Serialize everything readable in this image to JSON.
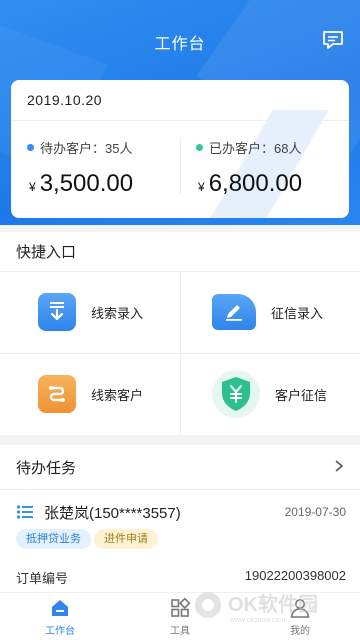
{
  "header": {
    "title": "工作台",
    "message_icon": "message-icon"
  },
  "summary": {
    "date": "2019.10.20",
    "pending": {
      "label": "待办客户：35人",
      "currency": "¥",
      "amount": "3,500.00",
      "dot_color": "#2f8ff0"
    },
    "done": {
      "label": "已办客户：68人",
      "currency": "¥",
      "amount": "6,800.00",
      "dot_color": "#34c7a0"
    }
  },
  "quick_entry": {
    "title": "快捷入口",
    "items": [
      {
        "label": "线索录入",
        "icon": "download-icon",
        "color": "#3b8ff0"
      },
      {
        "label": "征信录入",
        "icon": "edit-icon",
        "color": "#3b8ff0"
      },
      {
        "label": "线索客户",
        "icon": "swap-icon",
        "color": "#f3a34a"
      },
      {
        "label": "客户征信",
        "icon": "yen-shield-icon",
        "color": "#2cc08f"
      }
    ]
  },
  "tasks": {
    "title": "待办任务",
    "item": {
      "name": "张楚岚(150****3557)",
      "date": "2019-07-30",
      "tags": [
        "抵押贷业务",
        "进件申请"
      ],
      "order_label": "订单编号",
      "order_value": "19022200398002"
    }
  },
  "tabbar": {
    "items": [
      {
        "label": "工作台",
        "icon": "home-icon",
        "active": true
      },
      {
        "label": "工具",
        "icon": "tools-icon",
        "active": false
      },
      {
        "label": "我的",
        "icon": "profile-icon",
        "active": false
      }
    ]
  },
  "watermark": {
    "text": "OK软件园",
    "sub": "www.okshow.com"
  }
}
